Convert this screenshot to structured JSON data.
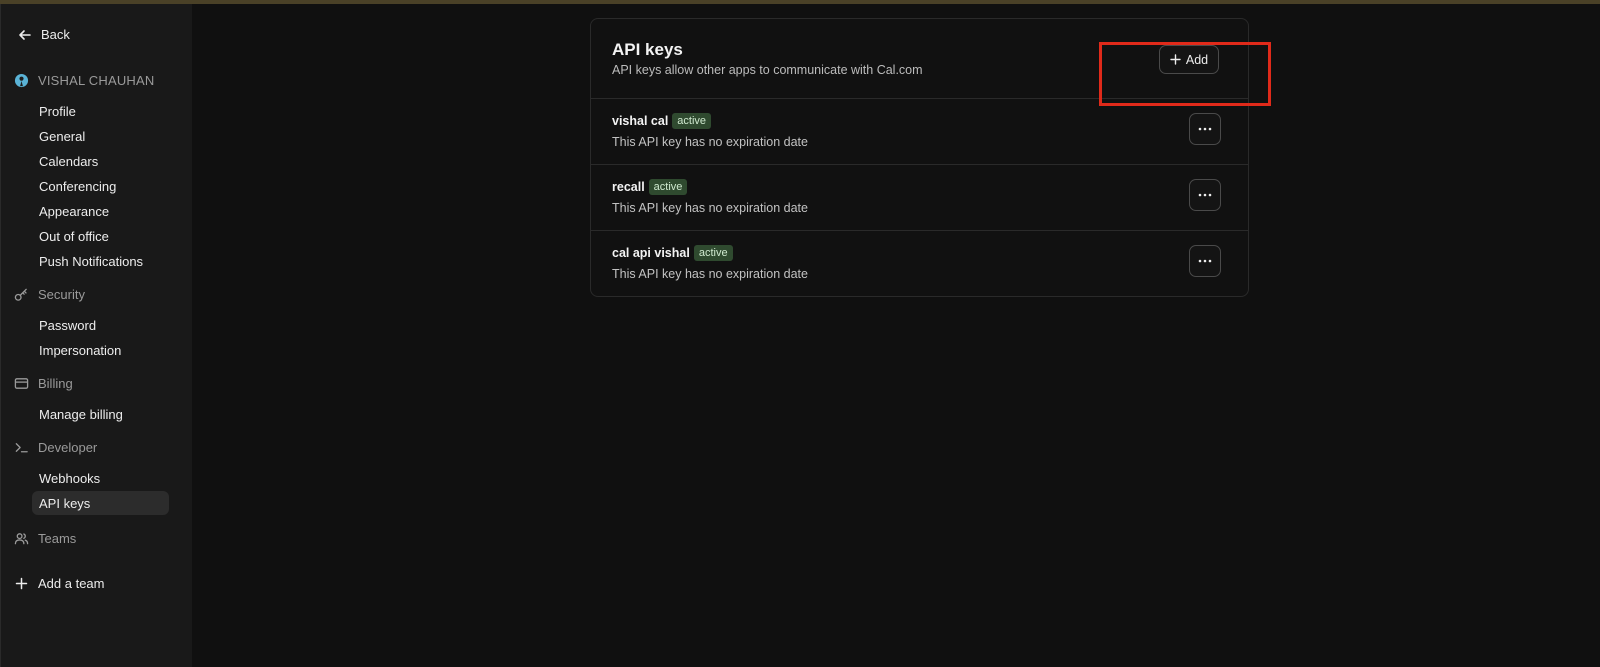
{
  "sidebar": {
    "back_label": "Back",
    "user_name": "VISHAL CHAUHAN",
    "profile_items": [
      "Profile",
      "General",
      "Calendars",
      "Conferencing",
      "Appearance",
      "Out of office",
      "Push Notifications"
    ],
    "security": {
      "title": "Security",
      "items": [
        "Password",
        "Impersonation"
      ]
    },
    "billing": {
      "title": "Billing",
      "items": [
        "Manage billing"
      ]
    },
    "developer": {
      "title": "Developer",
      "items": [
        "Webhooks",
        "API keys"
      ],
      "active": "API keys"
    },
    "teams": {
      "title": "Teams"
    },
    "add_team_label": "Add a team"
  },
  "main": {
    "title": "API keys",
    "subtitle": "API keys allow other apps to communicate with Cal.com",
    "add_label": "Add",
    "keys": [
      {
        "name": "vishal cal",
        "status": "active",
        "description": "This API key has no expiration date"
      },
      {
        "name": "recall",
        "status": "active",
        "description": "This API key has no expiration date"
      },
      {
        "name": "cal api vishal",
        "status": "active",
        "description": "This API key has no expiration date"
      }
    ]
  },
  "colors": {
    "background": "#101010",
    "sidebar": "#191919",
    "badge_bg": "#2f4a2f",
    "highlight": "#e02a1a",
    "top_bar": "#4a4127"
  },
  "icons": [
    "arrow-left-icon",
    "user-avatar-icon",
    "key-icon",
    "credit-card-icon",
    "terminal-icon",
    "users-icon",
    "plus-icon",
    "ellipsis-icon"
  ]
}
